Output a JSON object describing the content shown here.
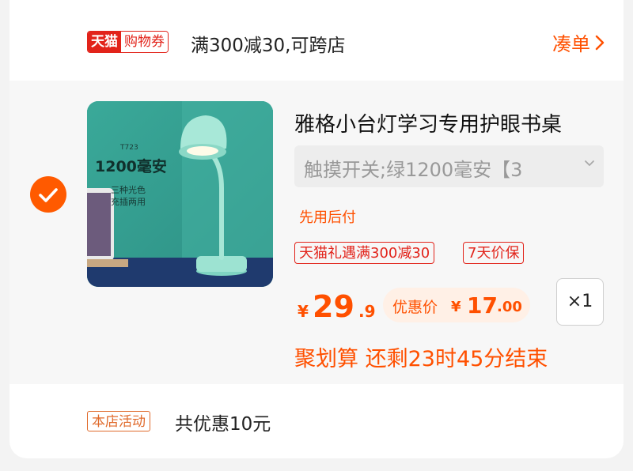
{
  "promo_bar": {
    "tmall_label": "天猫",
    "coupon_label": "购物券",
    "text": "满300减30,可跨店",
    "cou_dan_label": "凑单",
    "chevron_icon": "chevron-right-icon"
  },
  "product": {
    "selected": true,
    "image": {
      "model_code": "T723",
      "capacity_text": "1200毫安",
      "features_line1": "三种光色",
      "features_line2": "充插两用"
    },
    "title": "雅格小台灯学习专用护眼书桌",
    "sku": "触摸开关;绿1200毫安【3",
    "pay_later": "先用后付",
    "badges": [
      "天猫礼遇满300减30",
      "7天价保"
    ],
    "price": {
      "currency": "¥",
      "integer": "29",
      "decimal": ".9"
    },
    "discount": {
      "label": "优惠价",
      "currency": "¥",
      "integer": "17",
      "decimal": ".00"
    },
    "quantity": "×1",
    "countdown": "聚划算 还剩23时45分结束"
  },
  "shop_activity": {
    "tag": "本店活动",
    "text": "共优惠10元"
  },
  "colors": {
    "accent": "#ff5000",
    "tmall_red": "#e2231a",
    "check_orange": "#ff5a00"
  }
}
